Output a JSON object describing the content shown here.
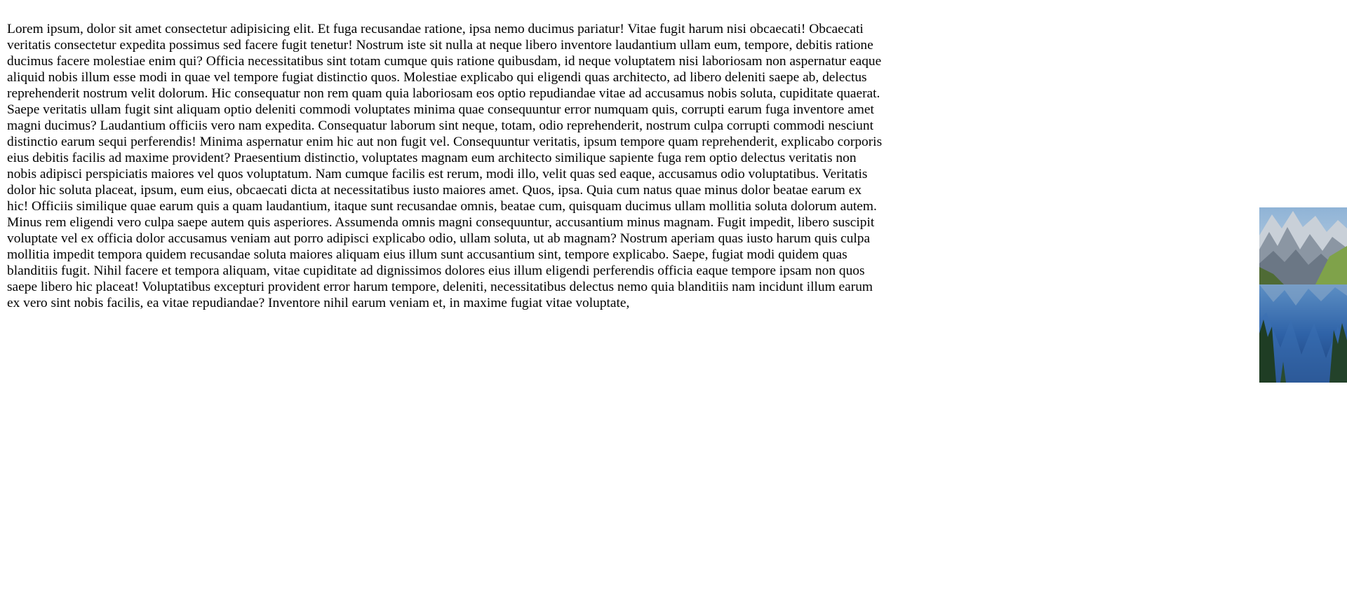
{
  "content": {
    "paragraph": "Lorem ipsum, dolor sit amet consectetur adipisicing elit. Et fuga recusandae ratione, ipsa nemo ducimus pariatur! Vitae fugit harum nisi obcaecati! Obcaecati veritatis consectetur expedita possimus sed facere fugit tenetur! Nostrum iste sit nulla at neque libero inventore laudantium ullam eum, tempore, debitis ratione ducimus facere molestiae enim qui? Officia necessitatibus sint totam cumque quis ratione quibusdam, id neque voluptatem nisi laboriosam non aspernatur eaque aliquid nobis illum esse modi in quae vel tempore fugiat distinctio quos. Molestiae explicabo qui eligendi quas architecto, ad libero deleniti saepe ab, delectus reprehenderit nostrum velit dolorum. Hic consequatur non rem quam quia laboriosam eos optio repudiandae vitae ad accusamus nobis soluta, cupiditate quaerat. Saepe veritatis ullam fugit sint aliquam optio deleniti commodi voluptates minima quae consequuntur error numquam quis, corrupti earum fuga inventore amet magni ducimus? Laudantium officiis vero nam expedita. Consequatur laborum sint neque, totam, odio reprehenderit, nostrum culpa corrupti commodi nesciunt distinctio earum sequi perferendis! Minima aspernatur enim hic aut non fugit vel. Consequuntur veritatis, ipsum tempore quam reprehenderit, explicabo corporis eius debitis facilis ad maxime provident? Praesentium distinctio, voluptates magnam eum architecto similique sapiente fuga rem optio delectus veritatis non nobis adipisci perspiciatis maiores vel quos voluptatum. Nam cumque facilis est rerum, modi illo, velit quas sed eaque, accusamus odio voluptatibus. Veritatis dolor hic soluta placeat, ipsum, eum eius, obcaecati dicta at necessitatibus iusto maiores amet. Quos, ipsa. Quia cum natus quae minus dolor beatae earum ex hic! Officiis similique quae earum quis a quam laudantium, itaque sunt recusandae omnis, beatae cum, quisquam ducimus ullam mollitia soluta dolorum autem. Minus rem eligendi vero culpa saepe autem quis asperiores. Assumenda omnis magni consequuntur, accusantium minus magnam. Fugit impedit, libero suscipit voluptate vel ex officia dolor accusamus veniam aut porro adipisci explicabo odio, ullam soluta, ut ab magnam? Nostrum aperiam quas iusto harum quis culpa mollitia impedit tempora quidem recusandae soluta maiores aliquam eius illum sunt accusantium sint, tempore explicabo. Saepe, fugiat modi quidem quas blanditiis fugit. Nihil facere et tempora aliquam, vitae cupiditate ad dignissimos dolores eius illum eligendi perferendis officia eaque tempore ipsam non quos saepe libero hic placeat! Voluptatibus excepturi provident error harum tempore, deleniti, necessitatibus delectus nemo quia blanditiis nam incidunt illum earum ex vero sint nobis facilis, ea vitae repudiandae? Inventore nihil earum veniam et, in maxime fugiat vitae voluptate,"
  },
  "image": {
    "subject": "mountain-lake-photo",
    "colors": {
      "sky": "#a9c4dc",
      "mountain_light": "#d9dde2",
      "mountain_dark": "#6b7785",
      "forest": "#5a7a3a",
      "water": "#2f63a8",
      "water_dark": "#1c3f78"
    }
  }
}
